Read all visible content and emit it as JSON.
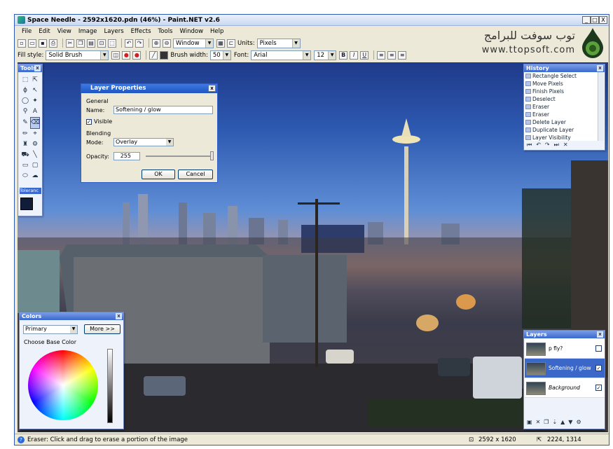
{
  "window": {
    "title": "Space Needle - 2592x1620.pdn (46%) - Paint.NET v2.6",
    "min": "_",
    "max": "□",
    "close": "X"
  },
  "menu": [
    "File",
    "Edit",
    "View",
    "Image",
    "Layers",
    "Effects",
    "Tools",
    "Window",
    "Help"
  ],
  "toolbar": {
    "zoom_value": "Window",
    "units_label": "Units:",
    "units_value": "Pixels"
  },
  "toolbar2": {
    "fill_label": "Fill style:",
    "fill_value": "Solid Brush",
    "brush_label": "Brush width:",
    "brush_value": "50",
    "font_label": "Font:",
    "font_value": "Arial",
    "font_size": "12",
    "bold": "B",
    "italic": "I",
    "underline": "U"
  },
  "logo": {
    "arabic": "توب سوفت للبرامج",
    "url": "www.ttopsoft.com"
  },
  "tools_palette": {
    "title": "Tools",
    "tolerance": "Toleranc"
  },
  "layer_dialog": {
    "title": "Layer Properties",
    "general": "General",
    "name_label": "Name:",
    "name_value": "Softening / glow",
    "visible_label": "Visible",
    "blending": "Blending",
    "mode_label": "Mode:",
    "mode_value": "Overlay",
    "opacity_label": "Opacity:",
    "opacity_value": "255",
    "ok": "OK",
    "cancel": "Cancel"
  },
  "history": {
    "title": "History",
    "items": [
      "Rectangle Select",
      "Move Pixels",
      "Finish Pixels",
      "Deselect",
      "Eraser",
      "Eraser",
      "Delete Layer",
      "Duplicate Layer",
      "Layer Visibility"
    ]
  },
  "layers": {
    "title": "Layers",
    "items": [
      {
        "name": "p fly?",
        "checked": false
      },
      {
        "name": "Softening / glow",
        "checked": true
      },
      {
        "name": "Background",
        "checked": true
      }
    ]
  },
  "colors": {
    "title": "Colors",
    "primary": "Primary",
    "more": "More >>",
    "choose": "Choose Base Color"
  },
  "status": {
    "hint": "Eraser: Click and drag to erase a portion of the image",
    "size": "2592 x 1620",
    "coords": "2224, 1314"
  }
}
